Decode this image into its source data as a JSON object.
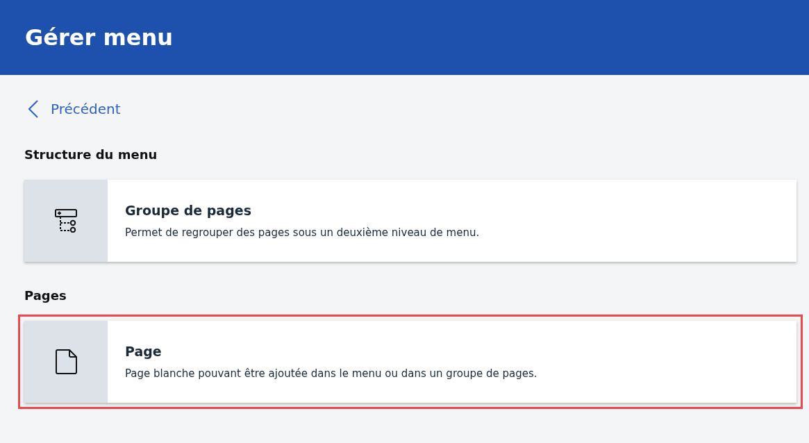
{
  "header": {
    "title": "Gérer menu"
  },
  "back_link": {
    "label": "Précédent"
  },
  "sections": [
    {
      "title": "Structure du menu",
      "items": [
        {
          "kind": "group",
          "title": "Groupe de pages",
          "description": "Permet de regrouper des pages sous un deuxième niveau de menu.",
          "highlighted": false
        }
      ]
    },
    {
      "title": "Pages",
      "items": [
        {
          "kind": "page",
          "title": "Page",
          "description": "Page blanche pouvant être ajoutée dans le menu ou dans un groupe de pages.",
          "highlighted": true
        }
      ]
    }
  ]
}
